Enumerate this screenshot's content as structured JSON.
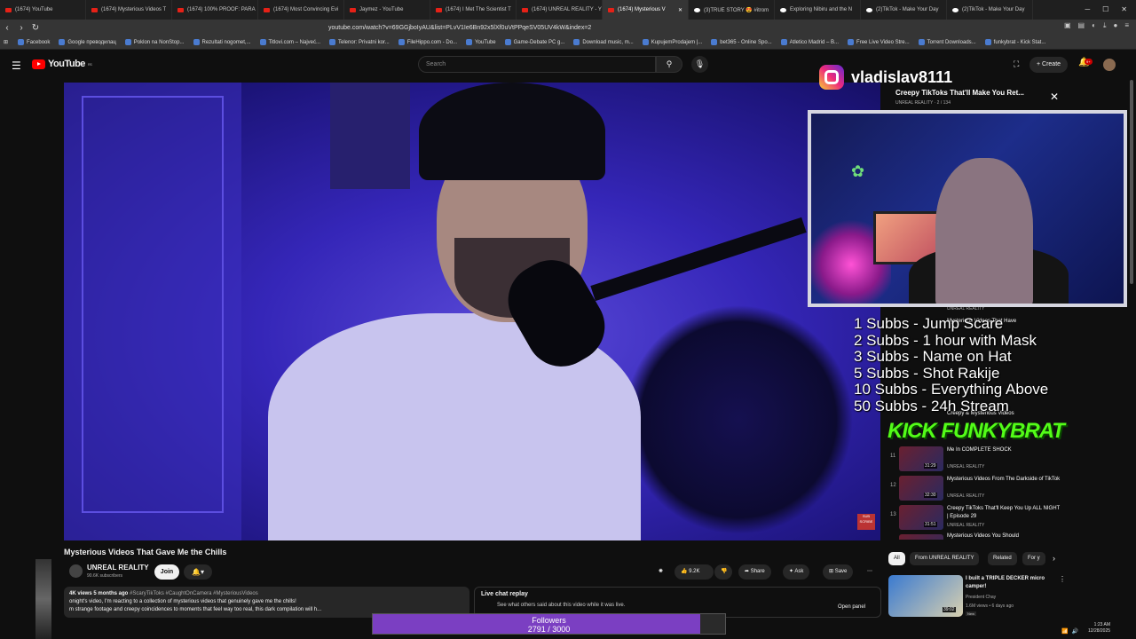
{
  "browser": {
    "tabs": [
      {
        "label": "(1674) YouTube",
        "type": "yt"
      },
      {
        "label": "(1674) Mysterious Videos T",
        "type": "yt"
      },
      {
        "label": "(1674) 100% PROOF: PARA",
        "type": "yt"
      },
      {
        "label": "(1674) Most Convincing Evi",
        "type": "yt"
      },
      {
        "label": "Jaymez - YouTube",
        "type": "yt"
      },
      {
        "label": "(1674) I Met The Scientist T",
        "type": "yt"
      },
      {
        "label": "(1674) UNREAL REALITY - Y",
        "type": "yt"
      },
      {
        "label": "(1674) Mysterious V",
        "type": "yt",
        "active": true
      },
      {
        "label": "(3)TRUE STORY 😍 #itrom",
        "type": "tk"
      },
      {
        "label": "Exploring Nibiru and the N",
        "type": "tk"
      },
      {
        "label": "(2)TikTok - Make Your Day",
        "type": "tk"
      },
      {
        "label": "(2)TikTok - Make Your Day",
        "type": "tk"
      }
    ],
    "url": "youtube.com/watch?v=69GGjboIyAU&list=PLvV1Ie6Bn92x5lXf0uVtPPqeSV05UV4kW&index=2",
    "bookmarks": [
      "Facebook",
      "Google преводилац",
      "Poklon na NonStop...",
      "Rezultati nogomet,...",
      "Titlovi.com – Najveć...",
      "Telenor: Privatni kor...",
      "FileHippo.com - Do...",
      "YouTube",
      "Game-Debate PC g...",
      "Download music, m...",
      "KupujemProdajem |...",
      "bet365 - Online Spo...",
      "Atletico Madrid – B...",
      "Free Live Video Stre...",
      "Torrent Downloads...",
      "funkybrat - Kick Stat..."
    ]
  },
  "youtube": {
    "logo_text": "YouTube",
    "logo_region": "RS",
    "search_placeholder": "Search",
    "create_label": "+ Create",
    "notif_count": "9+"
  },
  "video": {
    "title": "Mysterious Videos That Gave Me the Chills",
    "channel": "UNREAL REALITY",
    "subscribers": "90.6K subscribers",
    "join_label": "Join",
    "likes": "9.2K",
    "share_label": "Share",
    "ask_label": "Ask",
    "save_label": "Save",
    "sub_badge": "SUB SCRIBE",
    "desc_meta": "4K views  5 months ago",
    "desc_tags": "#ScaryTikToks #CaughtOnCamera #MysteriousVideos",
    "desc_line1": "onight's video, I'm reacting to a collection of mysterious videos that genuinely gave me the chills!",
    "desc_line2": "m strange footage and creepy coincidences to moments that feel way too real, this dark compilation will h..."
  },
  "live_chat": {
    "title": "Live chat replay",
    "subtitle": "See what others said about this video while it was live.",
    "open_panel": "Open panel"
  },
  "overlay": {
    "instagram_handle": "vladislav8111",
    "goals": [
      "1 Subbs - Jump Scare",
      "2 Subbs - 1 hour with Mask",
      "3 Subbs - Name on Hat",
      "5 Subbs - Shot Rakije",
      "10 Subbs - Everything Above",
      "50 Subbs - 24h Stream"
    ],
    "kick_text": "KICK FUNKYBRAT",
    "followers_label": "Followers",
    "followers_count": "2791 / 3000",
    "followers_progress": 0.93
  },
  "playlist": {
    "title": "Creepy TikToks That'll Make You Ret...",
    "channel_progress": "UNREAL REALITY · 2 / 134",
    "items": [
      {
        "num": "",
        "title": "Mysterious Videos That Have",
        "channel": "UNREAL REALITY",
        "duration": ""
      },
      {
        "num": "",
        "title": "Creepy & Mysterious Videos",
        "channel": "",
        "duration": ""
      },
      {
        "num": "11",
        "title": "Me In COMPLETE SHOCK",
        "channel": "UNREAL REALITY",
        "duration": "31:29"
      },
      {
        "num": "12",
        "title": "Mysterious Videos From The Darkside of TikTok",
        "channel": "UNREAL REALITY",
        "duration": "32:30"
      },
      {
        "num": "13",
        "title": "Creepy TikToks That'll Keep You Up ALL NIGHT | Episode 29",
        "channel": "UNREAL REALITY",
        "duration": "31:51"
      },
      {
        "num": "14",
        "title": "Mysterious Videos You Should",
        "channel": "",
        "duration": ""
      }
    ]
  },
  "chips": [
    "All",
    "From UNREAL REALITY",
    "Related",
    "For y"
  ],
  "recommended": {
    "title": "I built a TRIPLE DECKER micro camper!",
    "channel": "President Chay",
    "views": "1.6M views • 6 days ago",
    "badge": "New",
    "duration": "39:02"
  },
  "system": {
    "time": "1:23 AM",
    "date": "12/28/2025"
  },
  "colors": {
    "youtube_red": "#ff0000",
    "kick_green": "#53fc18",
    "followers_purple": "#7b3fc2"
  }
}
